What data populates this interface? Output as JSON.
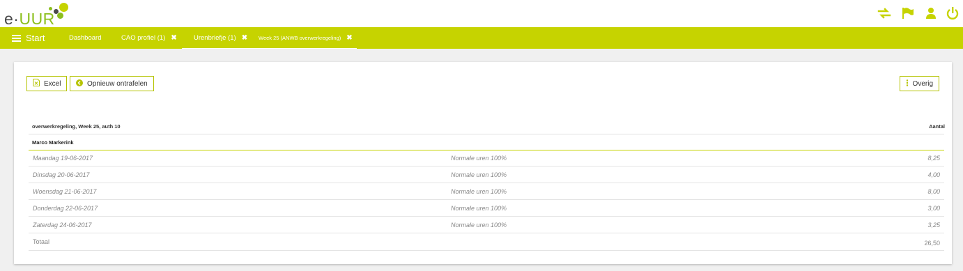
{
  "brand": {
    "logo_prefix": "e·",
    "logo_name": "UUR"
  },
  "top_icons": [
    "switch-arrows-icon",
    "flag-icon",
    "user-icon",
    "power-icon"
  ],
  "nav": {
    "start_label": "Start",
    "tabs": [
      {
        "label": "Dashboard",
        "closable": false
      },
      {
        "label": "CAO profiel (1)",
        "closable": true
      },
      {
        "label": "Urenbriefje (1)",
        "closable": true
      },
      {
        "label": "Week 25 (ANWB overwerkregeling)",
        "closable": true
      }
    ],
    "close_glyph": "✖"
  },
  "toolbar": {
    "excel_label": "Excel",
    "unravel_label": "Opnieuw ontrafelen",
    "other_label": "Overig"
  },
  "table": {
    "title": "overwerkregeling, Week 25, auth 10",
    "count_header": "Aantal",
    "group": "Marco Markerink",
    "rows": [
      {
        "day": "Maandag 19-06-2017",
        "type": "Normale uren 100%",
        "amount": "8,25"
      },
      {
        "day": "Dinsdag 20-06-2017",
        "type": "Normale uren 100%",
        "amount": "4,00"
      },
      {
        "day": "Woensdag 21-06-2017",
        "type": "Normale uren 100%",
        "amount": "8,00"
      },
      {
        "day": "Donderdag 22-06-2017",
        "type": "Normale uren 100%",
        "amount": "3,00"
      },
      {
        "day": "Zaterdag 24-06-2017",
        "type": "Normale uren 100%",
        "amount": "3,25"
      }
    ],
    "total_label": "Totaal",
    "total_amount": "26,50"
  },
  "colors": {
    "accent": "#c6d300",
    "logo_green": "#8cbf1e",
    "text": "#333333"
  }
}
